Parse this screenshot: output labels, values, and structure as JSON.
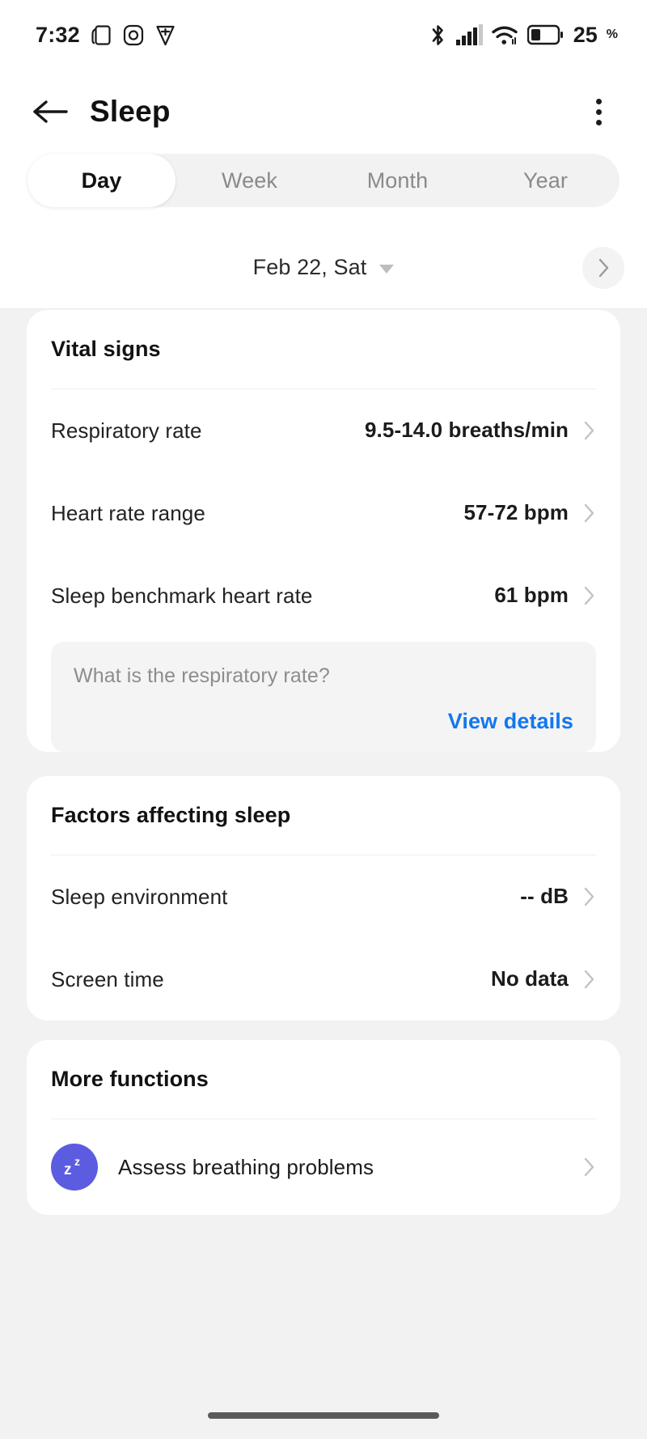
{
  "status_bar": {
    "time": "7:32",
    "icons_left": [
      "tablet-icon",
      "camera-icon",
      "shield-icon"
    ],
    "icons_right": [
      "bluetooth-icon",
      "cellular-signal-icon",
      "wifi-icon",
      "battery-icon"
    ],
    "battery_level": "25",
    "battery_unit": "%"
  },
  "app_bar": {
    "back_label": "back-arrow",
    "title": "Sleep",
    "overflow_label": "more-options"
  },
  "tabs": {
    "items": [
      {
        "label": "Day",
        "active": true
      },
      {
        "label": "Week",
        "active": false
      },
      {
        "label": "Month",
        "active": false
      },
      {
        "label": "Year",
        "active": false
      }
    ]
  },
  "date_selector": {
    "value": "Feb 22, Sat",
    "next_label": "next-day"
  },
  "cards": {
    "vital_signs": {
      "title": "Vital signs",
      "rows": [
        {
          "label": "Respiratory rate",
          "value": "9.5-14.0 breaths/min"
        },
        {
          "label": "Heart rate range",
          "value": "57-72 bpm"
        },
        {
          "label": "Sleep benchmark heart rate",
          "value": "61 bpm"
        }
      ],
      "info": {
        "question": "What is the respiratory rate?",
        "link": "View details"
      }
    },
    "factors": {
      "title": "Factors affecting sleep",
      "rows": [
        {
          "label": "Sleep environment",
          "value": "--  dB"
        },
        {
          "label": "Screen time",
          "value": "No data"
        }
      ]
    },
    "more_functions": {
      "title": "More functions",
      "rows": [
        {
          "label": "Assess breathing problems",
          "icon": "sleep-zzz-icon"
        }
      ]
    }
  },
  "colors": {
    "link_blue": "#1277f0",
    "icon_purple": "#5c5ce0",
    "chevron_grey": "#c2c2c2",
    "page_bg": "#f2f2f2",
    "card_bg": "#ffffff"
  }
}
